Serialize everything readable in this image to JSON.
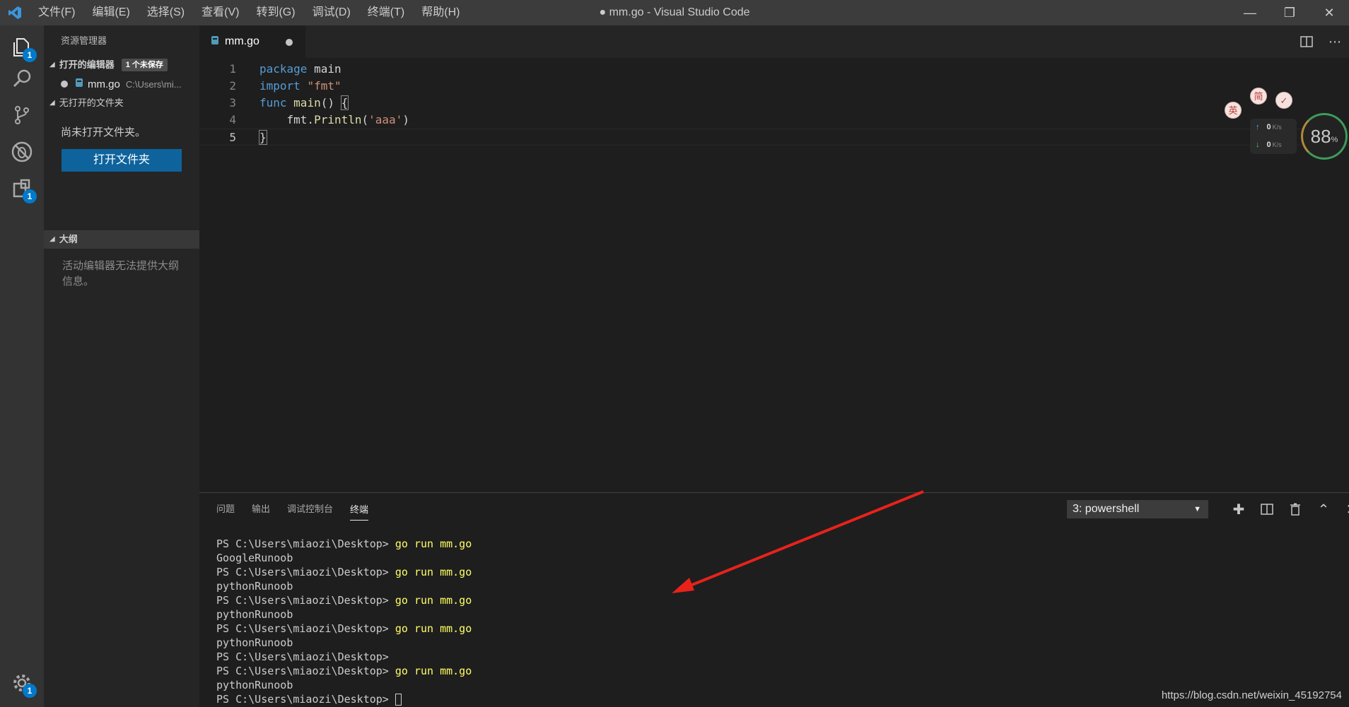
{
  "window": {
    "title": "● mm.go - Visual Studio Code",
    "menu": [
      "文件(F)",
      "编辑(E)",
      "选择(S)",
      "查看(V)",
      "转到(G)",
      "调试(D)",
      "终端(T)",
      "帮助(H)"
    ]
  },
  "activity": {
    "explorer_badge": "1",
    "extensions_badge": "1",
    "settings_badge": "1"
  },
  "sidebar": {
    "title": "资源管理器",
    "open_editors": {
      "label": "打开的编辑器",
      "badge": "1 个未保存",
      "items": [
        {
          "name": "mm.go",
          "path": "C:\\Users\\mi..."
        }
      ]
    },
    "no_folder": {
      "label": "无打开的文件夹",
      "message": "尚未打开文件夹。",
      "button": "打开文件夹"
    },
    "outline": {
      "label": "大纲",
      "message": "活动编辑器无法提供大纲信息。"
    }
  },
  "editor": {
    "tab": "mm.go",
    "lines": [
      {
        "num": "1",
        "tokens": [
          {
            "t": "package",
            "c": "kw"
          },
          {
            "t": " main",
            "c": ""
          }
        ]
      },
      {
        "num": "2",
        "tokens": [
          {
            "t": "import",
            "c": "kw"
          },
          {
            "t": " ",
            "c": ""
          },
          {
            "t": "\"fmt\"",
            "c": "str"
          }
        ]
      },
      {
        "num": "3",
        "tokens": [
          {
            "t": "func",
            "c": "kw"
          },
          {
            "t": " ",
            "c": ""
          },
          {
            "t": "main",
            "c": "fn"
          },
          {
            "t": "() ",
            "c": ""
          },
          {
            "t": "{",
            "c": "brk"
          }
        ]
      },
      {
        "num": "4",
        "tokens": [
          {
            "t": "    fmt.",
            "c": ""
          },
          {
            "t": "Println",
            "c": "fn"
          },
          {
            "t": "(",
            "c": ""
          },
          {
            "t": "'aaa'",
            "c": "str"
          },
          {
            "t": ")",
            "c": ""
          }
        ]
      },
      {
        "num": "5",
        "tokens": [
          {
            "t": "}",
            "c": "brk"
          }
        ]
      }
    ]
  },
  "panel": {
    "tabs": [
      "问题",
      "输出",
      "调试控制台",
      "终端"
    ],
    "active_tab": "终端",
    "terminal_select": "3: powershell",
    "terminal_lines": [
      {
        "prompt": "PS C:\\Users\\miaozi\\Desktop> ",
        "cmd": "go run mm.go"
      },
      {
        "prompt": "GoogleRunoob",
        "cmd": ""
      },
      {
        "prompt": "PS C:\\Users\\miaozi\\Desktop> ",
        "cmd": "go run mm.go"
      },
      {
        "prompt": "pythonRunoob",
        "cmd": ""
      },
      {
        "prompt": "PS C:\\Users\\miaozi\\Desktop> ",
        "cmd": "go run mm.go"
      },
      {
        "prompt": "pythonRunoob",
        "cmd": ""
      },
      {
        "prompt": "PS C:\\Users\\miaozi\\Desktop> ",
        "cmd": "go run mm.go"
      },
      {
        "prompt": "pythonRunoob",
        "cmd": ""
      },
      {
        "prompt": "PS C:\\Users\\miaozi\\Desktop>",
        "cmd": ""
      },
      {
        "prompt": "PS C:\\Users\\miaozi\\Desktop> ",
        "cmd": "go run mm.go"
      },
      {
        "prompt": "pythonRunoob",
        "cmd": ""
      },
      {
        "prompt": "PS C:\\Users\\miaozi\\Desktop> ",
        "cmd": "",
        "cursor": true
      }
    ]
  },
  "widget": {
    "chips": [
      "英",
      "简"
    ],
    "upload": "0",
    "download": "0",
    "unit": "K/s",
    "percent_value": "88",
    "percent_sign": "%"
  },
  "watermark": "https://blog.csdn.net/weixin_45192754",
  "colors": {
    "accent": "#007acc",
    "button": "#0e639c",
    "arrow": "#e8221b"
  }
}
